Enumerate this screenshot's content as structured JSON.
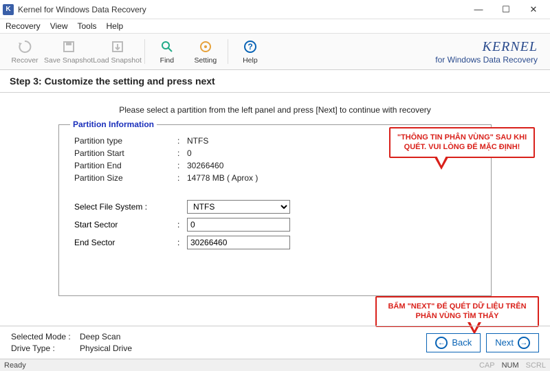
{
  "window": {
    "title": "Kernel for Windows Data Recovery"
  },
  "menu": {
    "recovery": "Recovery",
    "view": "View",
    "tools": "Tools",
    "help": "Help"
  },
  "toolbar": {
    "recover": "Recover",
    "save_snapshot": "Save Snapshot",
    "load_snapshot": "Load Snapshot",
    "find": "Find",
    "setting": "Setting",
    "help": "Help"
  },
  "brand": {
    "name": "KERNEL",
    "tagline": "for Windows Data Recovery"
  },
  "step": {
    "title": "Step 3: Customize the setting and press next"
  },
  "instruction": "Please select a partition from the left panel and press [Next] to continue with recovery",
  "fieldset": {
    "legend": "Partition Information"
  },
  "info": {
    "type_label": "Partition type",
    "type_value": "NTFS",
    "start_label": "Partition Start",
    "start_value": "0",
    "end_label": "Partition End",
    "end_value": "30266460",
    "size_label": "Partition Size",
    "size_value": "14778 MB ( Aprox )"
  },
  "form": {
    "fs_label": "Select File System :",
    "fs_value": "NTFS",
    "start_label": "Start Sector",
    "start_value": "0",
    "end_label": "End Sector",
    "end_value": "30266460"
  },
  "callouts": {
    "c1": "\"THÔNG TIN PHÂN VÙNG\" SAU KHI QUÉT. VUI LÒNG ĐỂ MẶC ĐỊNH!",
    "c2": "BẤM \"NEXT\" ĐỂ QUÉT DỮ LIỆU TRÊN PHÂN VÙNG TÌM THẤY"
  },
  "footer": {
    "mode_label": "Selected Mode :",
    "mode_value": "Deep Scan",
    "drive_label": "Drive Type :",
    "drive_value": "Physical Drive",
    "back": "Back",
    "next": "Next"
  },
  "status": {
    "ready": "Ready",
    "cap": "CAP",
    "num": "NUM",
    "scrl": "SCRL"
  }
}
